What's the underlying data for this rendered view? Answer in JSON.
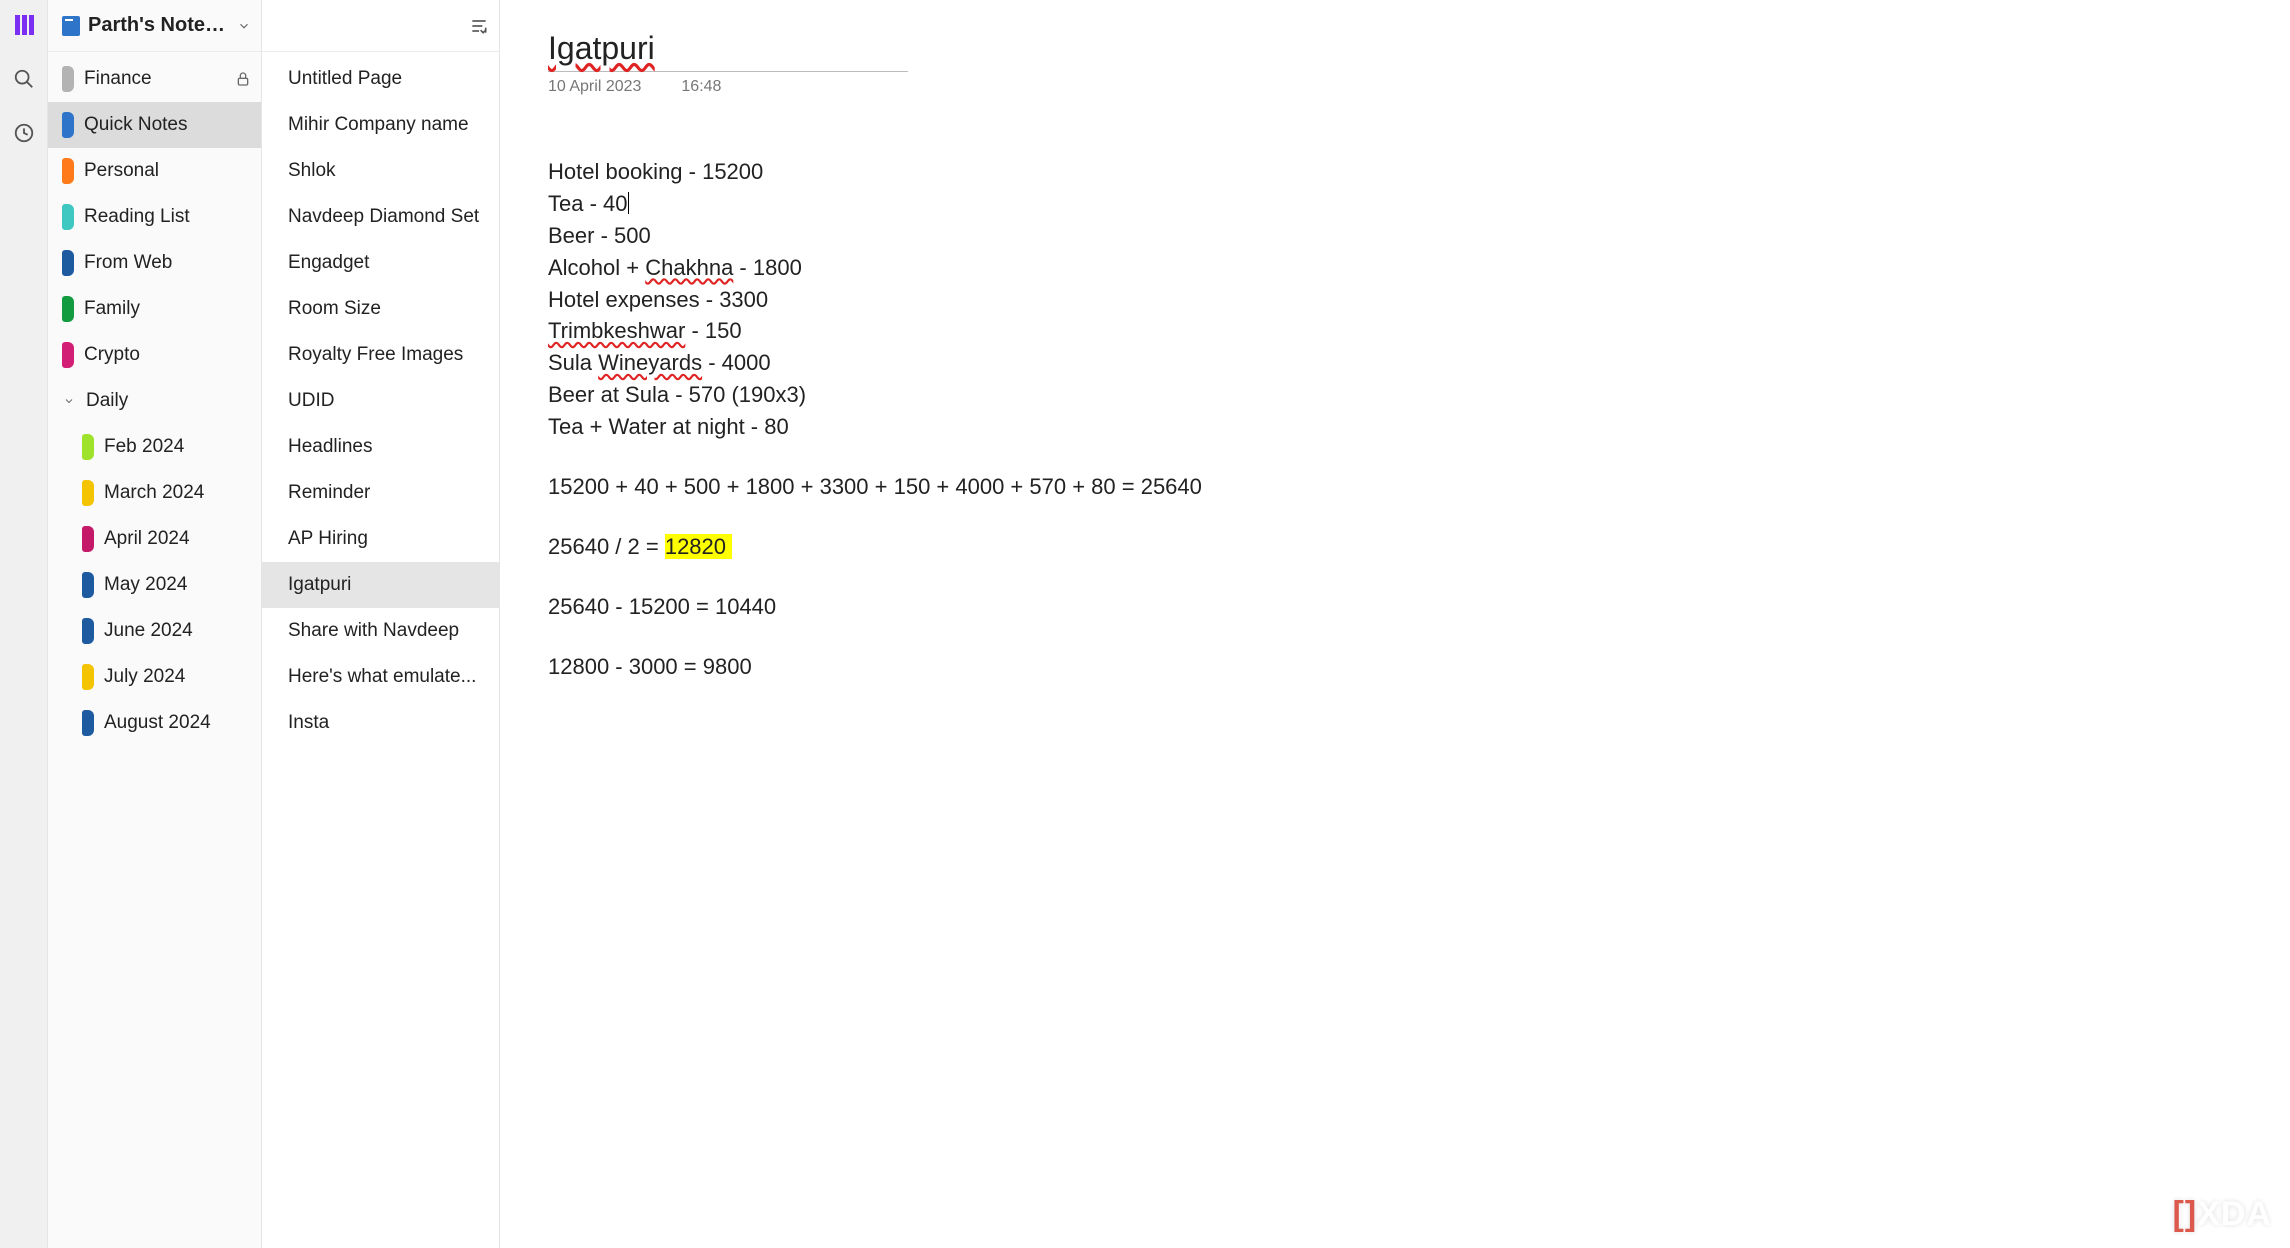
{
  "notebook": {
    "title": "Parth's Notebook",
    "sections": [
      {
        "label": "Finance",
        "color": "#b3b3b3",
        "locked": true,
        "selected": false
      },
      {
        "label": "Quick Notes",
        "color": "#2e74c9",
        "locked": false,
        "selected": true
      },
      {
        "label": "Personal",
        "color": "#ff7a1a",
        "locked": false,
        "selected": false
      },
      {
        "label": "Reading List",
        "color": "#3ec8c1",
        "locked": false,
        "selected": false
      },
      {
        "label": "From Web",
        "color": "#1d5aa0",
        "locked": false,
        "selected": false
      },
      {
        "label": "Family",
        "color": "#129b3f",
        "locked": false,
        "selected": false
      },
      {
        "label": "Crypto",
        "color": "#d21e75",
        "locked": false,
        "selected": false
      }
    ],
    "group": {
      "label": "Daily",
      "expanded": true,
      "children": [
        {
          "label": "Feb 2024",
          "color": "#9fe22c"
        },
        {
          "label": "March 2024",
          "color": "#f5c400"
        },
        {
          "label": "April 2024",
          "color": "#c41968"
        },
        {
          "label": "May 2024",
          "color": "#1d5aa0"
        },
        {
          "label": "June 2024",
          "color": "#1d5aa0"
        },
        {
          "label": "July 2024",
          "color": "#f5c400"
        },
        {
          "label": "August 2024",
          "color": "#1d5aa0"
        }
      ]
    }
  },
  "pages": [
    {
      "title": "Untitled Page",
      "selected": false
    },
    {
      "title": "Mihir Company name",
      "selected": false
    },
    {
      "title": "Shlok",
      "selected": false
    },
    {
      "title": "Navdeep Diamond Set",
      "selected": false
    },
    {
      "title": "Engadget",
      "selected": false
    },
    {
      "title": "Room Size",
      "selected": false
    },
    {
      "title": "Royalty Free Images",
      "selected": false
    },
    {
      "title": "UDID",
      "selected": false
    },
    {
      "title": "Headlines",
      "selected": false
    },
    {
      "title": "Reminder",
      "selected": false
    },
    {
      "title": "AP Hiring",
      "selected": false
    },
    {
      "title": "Igatpuri",
      "selected": true
    },
    {
      "title": "Share with Navdeep",
      "selected": false
    },
    {
      "title": "Here's what emulate...",
      "selected": false
    },
    {
      "title": "Insta",
      "selected": false
    }
  ],
  "note": {
    "title": "Igatpuri",
    "date": "10 April 2023",
    "time": "16:48",
    "lines": [
      "Hotel booking - 15200",
      "Tea - 40",
      "Beer - 500",
      "Alcohol + Chakhna - 1800",
      "Hotel expenses - 3300",
      "Trimbkeshwar - 150",
      "Sula Wineyards - 4000",
      "Beer at Sula - 570 (190x3)",
      "Tea + Water at night - 80"
    ],
    "sum_line": "15200 + 40 + 500 + 1800 + 3300 + 150 + 4000 + 570 + 80 = 25640",
    "half_prefix": "25640 / 2 = ",
    "half_value": "12820",
    "diff1": "25640 - 15200 = 10440",
    "diff2": "12800 - 3000 = 9800"
  },
  "watermark": {
    "bracket": "[]",
    "text": "XDA"
  }
}
